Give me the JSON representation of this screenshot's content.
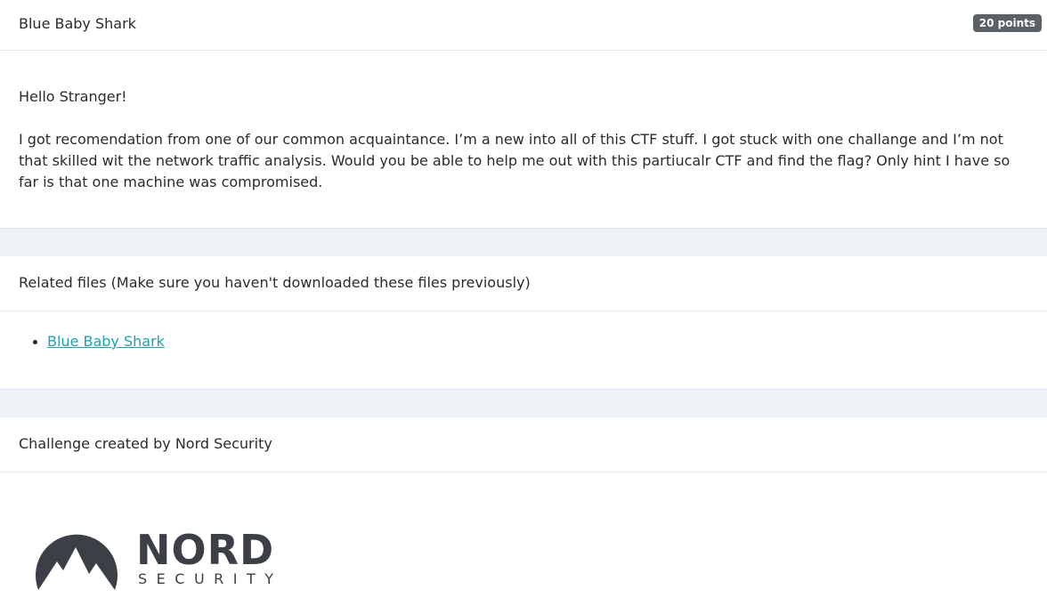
{
  "challenge": {
    "title": "Blue Baby Shark",
    "points": "20 points"
  },
  "body": {
    "greeting": "Hello Stranger!",
    "description": "I got recomendation from one of our common acquaintance. I’m a new into all of this CTF stuff. I got stuck with one challange and I’m not that skilled wit the network traffic analysis. Would you be able to help me out with this partiucalr CTF and find the flag? Only hint I have so far is that one machine was compromised."
  },
  "files": {
    "header": "Related files (Make sure you haven't downloaded these files previously)",
    "items": [
      {
        "label": "Blue Baby Shark"
      }
    ]
  },
  "author": {
    "text": "Challenge created by Nord Security"
  },
  "logo": {
    "word": "NORD",
    "sub": "SECURITY",
    "icon": "mountain-logo-icon",
    "color": "#3c4046"
  },
  "colors": {
    "link": "#1fa1b0",
    "badge": "#5c6166",
    "band": "#edf3f7"
  }
}
